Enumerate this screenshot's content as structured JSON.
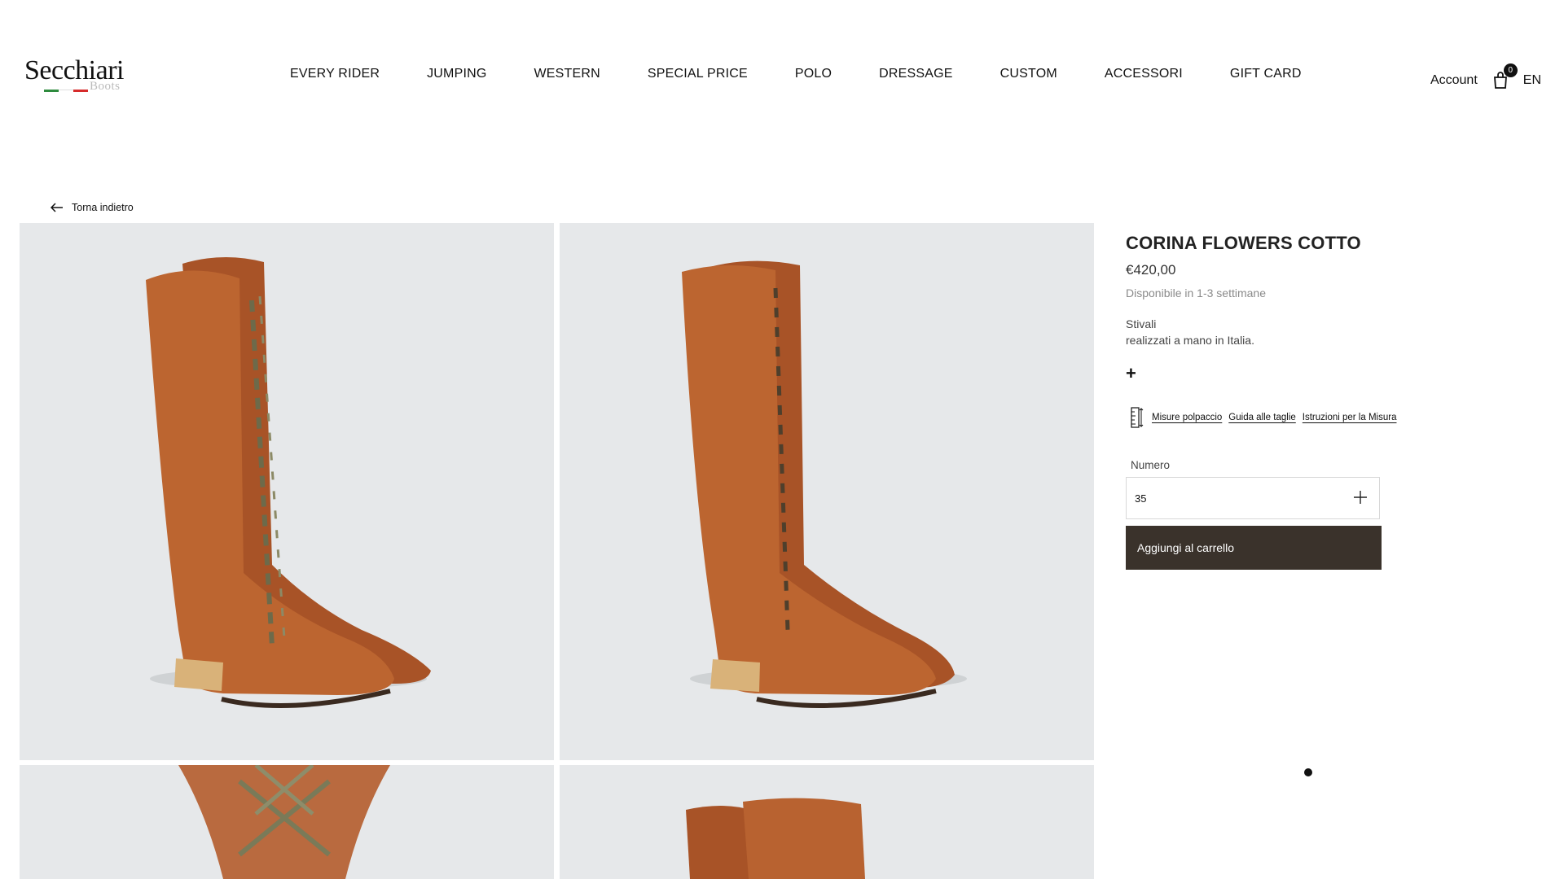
{
  "header": {
    "logo_text": "Secchiari",
    "logo_sub": "Boots",
    "flag_colors": [
      "#2e8b3e",
      "#ffffff",
      "#d62b2b"
    ],
    "nav": [
      "EVERY RIDER",
      "JUMPING",
      "WESTERN",
      "SPECIAL PRICE",
      "POLO",
      "DRESSAGE",
      "CUSTOM",
      "ACCESSORI",
      "GIFT CARD"
    ],
    "account_label": "Account",
    "cart_count": "0",
    "lang_label": "EN"
  },
  "back_label": "Torna indietro",
  "product": {
    "title": "CORINA FLOWERS COTTO",
    "price": "€420,00",
    "availability": "Disponibile in 1-3 settimane",
    "description_line1": "Stivali",
    "description_line2": "realizzati a mano in Italia.",
    "expand_symbol": "+",
    "size_links": [
      "Misure polpaccio",
      "Guida alle taglie",
      "Istruzioni per la Misura"
    ],
    "size_label": "Numero",
    "size_value": "35",
    "add_to_cart_label": "Aggiungi al carrello"
  },
  "colors": {
    "leather": "#b5612d",
    "image_bg": "#e6e8ea",
    "button_bg": "#3a322b"
  },
  "icons": [
    "arrow-left-icon",
    "cart-icon",
    "ruler-icon",
    "plus-icon"
  ]
}
